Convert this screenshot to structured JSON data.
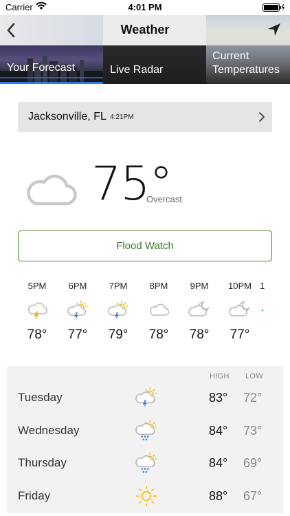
{
  "status_bar": {
    "carrier": "Carrier",
    "time": "4:01 PM"
  },
  "nav": {
    "title": "Weather",
    "back_icon": "chevron-left-icon",
    "location_icon": "location-arrow-icon"
  },
  "tabs": [
    {
      "label": "Your Forecast",
      "selected": true
    },
    {
      "label": "Live Radar",
      "selected": false
    },
    {
      "label": "Current Temperatures",
      "selected": false
    }
  ],
  "location": {
    "city": "Jacksonville, FL",
    "updated": "4:21PM"
  },
  "current": {
    "temperature": "75°",
    "condition": "Overcast",
    "icon": "cloud-icon"
  },
  "alert": {
    "label": "Flood Watch",
    "color": "#3d7a25"
  },
  "hourly": [
    {
      "time": "5PM",
      "icon": "cloud-lightning-icon",
      "temp": "78°"
    },
    {
      "time": "6PM",
      "icon": "sun-cloud-lightning-icon",
      "temp": "77°"
    },
    {
      "time": "7PM",
      "icon": "sun-cloud-lightning-icon",
      "temp": "79°"
    },
    {
      "time": "8PM",
      "icon": "cloud-icon",
      "temp": "78°"
    },
    {
      "time": "9PM",
      "icon": "moon-cloud-icon",
      "temp": "78°"
    },
    {
      "time": "10PM",
      "icon": "moon-cloud-icon",
      "temp": "77°"
    },
    {
      "time": "1",
      "icon": "partial-icon",
      "temp": ""
    }
  ],
  "daily": {
    "high_label": "HIGH",
    "low_label": "LOW",
    "days": [
      {
        "name": "Tuesday",
        "icon": "sun-cloud-lightning-icon",
        "high": "83°",
        "low": "72°"
      },
      {
        "name": "Wednesday",
        "icon": "sun-cloud-rain-icon",
        "high": "84°",
        "low": "73°"
      },
      {
        "name": "Thursday",
        "icon": "sun-cloud-rain-icon",
        "high": "84°",
        "low": "69°"
      },
      {
        "name": "Friday",
        "icon": "sun-icon",
        "high": "88°",
        "low": "67°"
      }
    ]
  },
  "colors": {
    "accent_blue": "#2a7de1",
    "sun_yellow": "#f3c322",
    "bolt_yellow": "#f3c322",
    "rain_blue": "#3a7fd6",
    "cloud_gray": "#c9c9c9"
  }
}
